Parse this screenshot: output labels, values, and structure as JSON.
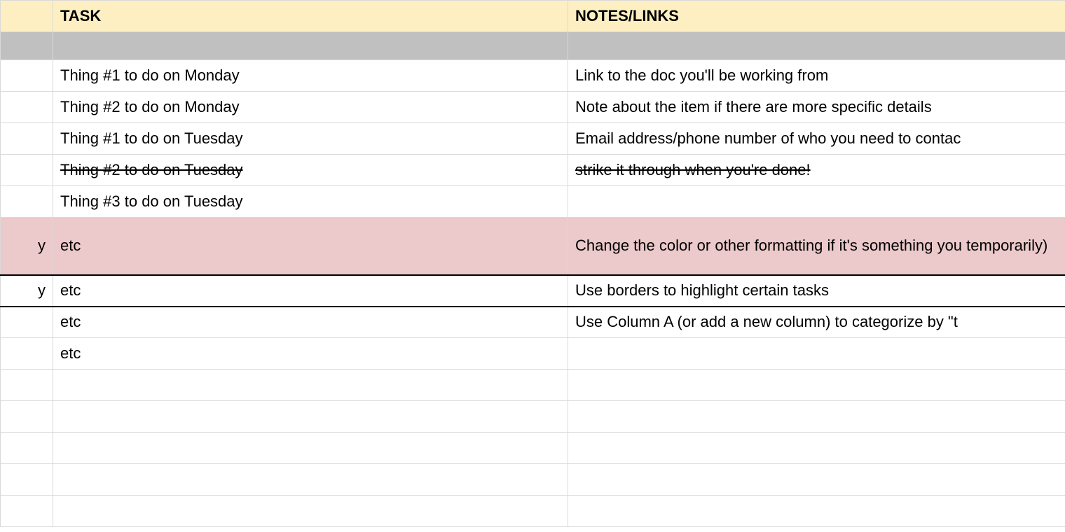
{
  "headers": {
    "task": "TASK",
    "notes": "NOTES/LINKS"
  },
  "rows": [
    {
      "type": "gray",
      "a": "",
      "task": "",
      "notes": ""
    },
    {
      "type": "normal",
      "a": "",
      "task": "Thing #1 to do on Monday",
      "notes": "Link to the doc you'll be working from"
    },
    {
      "type": "normal",
      "a": "",
      "task": "Thing #2 to do on Monday",
      "notes": "Note about the item if there are more specific details"
    },
    {
      "type": "normal",
      "a": "",
      "task": "Thing #1 to do on Tuesday",
      "notes": "Email address/phone number of who you need to contac"
    },
    {
      "type": "strike",
      "a": "",
      "task": "Thing #2 to do on Tuesday",
      "notes": "strike it through when you're done!"
    },
    {
      "type": "normal",
      "a": "",
      "task": "Thing #3 to do on Tuesday",
      "notes": ""
    },
    {
      "type": "pink-tall",
      "a": "y",
      "task": "etc",
      "notes": "Change the color or other formatting if it's something you temporarily)"
    },
    {
      "type": "border",
      "a": "y",
      "task": "etc",
      "notes": "Use borders to highlight certain tasks"
    },
    {
      "type": "normal",
      "a": "",
      "task": "etc",
      "notes": "Use Column A (or add a new column) to categorize by \"t"
    },
    {
      "type": "normal",
      "a": "",
      "task": "etc",
      "notes": ""
    },
    {
      "type": "normal",
      "a": "",
      "task": "",
      "notes": ""
    },
    {
      "type": "normal",
      "a": "",
      "task": "",
      "notes": ""
    },
    {
      "type": "normal",
      "a": "",
      "task": "",
      "notes": ""
    },
    {
      "type": "normal",
      "a": "",
      "task": "",
      "notes": ""
    },
    {
      "type": "normal",
      "a": "",
      "task": "",
      "notes": ""
    }
  ]
}
